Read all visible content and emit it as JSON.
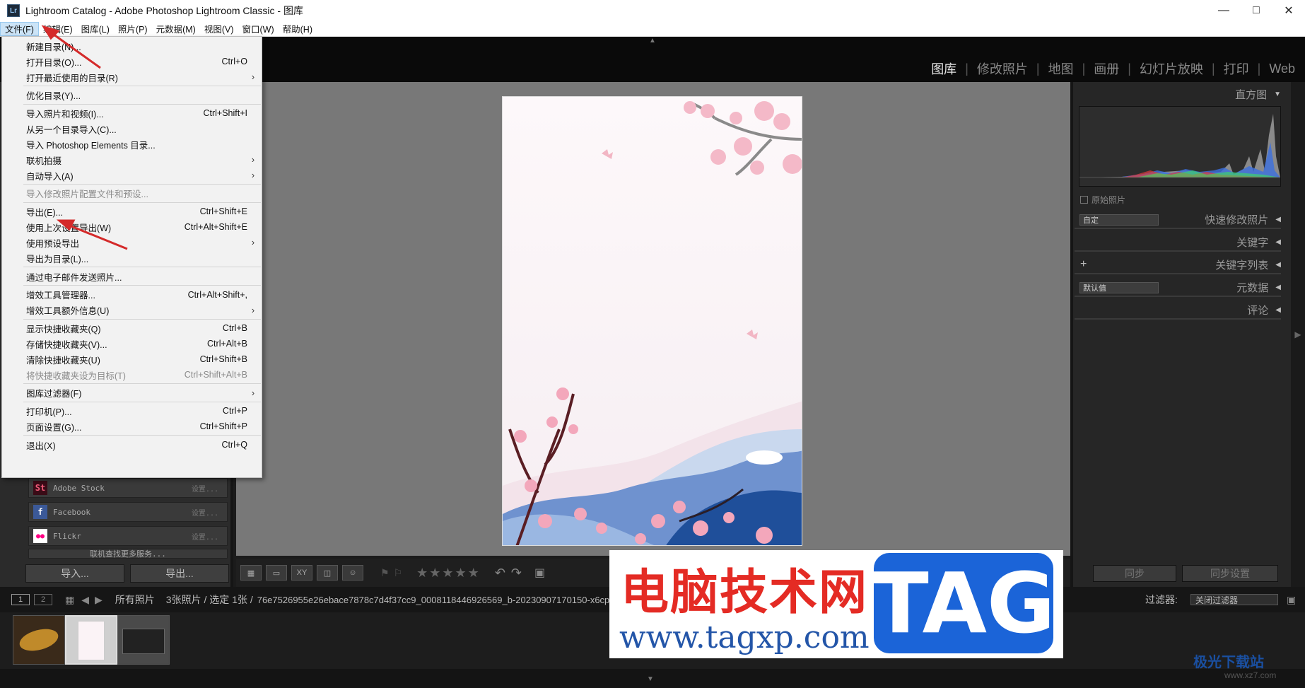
{
  "window": {
    "title": "Lightroom Catalog - Adobe Photoshop Lightroom Classic - 图库",
    "app_icon": "Lr"
  },
  "menubar": [
    "文件(F)",
    "编辑(E)",
    "图库(L)",
    "照片(P)",
    "元数据(M)",
    "视图(V)",
    "窗口(W)",
    "帮助(H)"
  ],
  "modules": [
    "图库",
    "修改照片",
    "地图",
    "画册",
    "幻灯片放映",
    "打印",
    "Web"
  ],
  "file_menu": [
    {
      "label": "新建目录(N)...",
      "shortcut": "",
      "submenu": false,
      "disabled": false
    },
    {
      "label": "打开目录(O)...",
      "shortcut": "Ctrl+O",
      "submenu": false,
      "disabled": false
    },
    {
      "label": "打开最近使用的目录(R)",
      "shortcut": "",
      "submenu": true,
      "disabled": false
    },
    {
      "label": "优化目录(Y)...",
      "shortcut": "",
      "submenu": false,
      "disabled": false
    },
    {
      "label": "导入照片和视频(I)...",
      "shortcut": "Ctrl+Shift+I",
      "submenu": false,
      "disabled": false
    },
    {
      "label": "从另一个目录导入(C)...",
      "shortcut": "",
      "submenu": false,
      "disabled": false
    },
    {
      "label": "导入 Photoshop Elements 目录...",
      "shortcut": "",
      "submenu": false,
      "disabled": false
    },
    {
      "label": "联机拍摄",
      "shortcut": "",
      "submenu": true,
      "disabled": false
    },
    {
      "label": "自动导入(A)",
      "shortcut": "",
      "submenu": true,
      "disabled": false
    },
    {
      "label": "导入修改照片配置文件和预设...",
      "shortcut": "",
      "submenu": false,
      "disabled": true
    },
    {
      "label": "导出(E)...",
      "shortcut": "Ctrl+Shift+E",
      "submenu": false,
      "disabled": false
    },
    {
      "label": "使用上次设置导出(W)",
      "shortcut": "Ctrl+Alt+Shift+E",
      "submenu": false,
      "disabled": false
    },
    {
      "label": "使用预设导出",
      "shortcut": "",
      "submenu": true,
      "disabled": false
    },
    {
      "label": "导出为目录(L)...",
      "shortcut": "",
      "submenu": false,
      "disabled": false
    },
    {
      "label": "通过电子邮件发送照片...",
      "shortcut": "",
      "submenu": false,
      "disabled": false
    },
    {
      "label": "增效工具管理器...",
      "shortcut": "Ctrl+Alt+Shift+,",
      "submenu": false,
      "disabled": false
    },
    {
      "label": "增效工具额外信息(U)",
      "shortcut": "",
      "submenu": true,
      "disabled": false
    },
    {
      "label": "显示快捷收藏夹(Q)",
      "shortcut": "Ctrl+B",
      "submenu": false,
      "disabled": false
    },
    {
      "label": "存储快捷收藏夹(V)...",
      "shortcut": "Ctrl+Alt+B",
      "submenu": false,
      "disabled": false
    },
    {
      "label": "清除快捷收藏夹(U)",
      "shortcut": "Ctrl+Shift+B",
      "submenu": false,
      "disabled": false
    },
    {
      "label": "将快捷收藏夹设为目标(T)",
      "shortcut": "Ctrl+Shift+Alt+B",
      "submenu": false,
      "disabled": true
    },
    {
      "label": "图库过滤器(F)",
      "shortcut": "",
      "submenu": true,
      "disabled": false
    },
    {
      "label": "打印机(P)...",
      "shortcut": "Ctrl+P",
      "submenu": false,
      "disabled": false
    },
    {
      "label": "页面设置(G)...",
      "shortcut": "Ctrl+Shift+P",
      "submenu": false,
      "disabled": false
    },
    {
      "label": "退出(X)",
      "shortcut": "Ctrl+Q",
      "submenu": false,
      "disabled": false
    }
  ],
  "publish": [
    {
      "icon": "St",
      "name": "Adobe Stock",
      "setting": "设置..."
    },
    {
      "icon": "f",
      "name": "Facebook",
      "setting": "设置..."
    },
    {
      "icon": "●●",
      "name": "Flickr",
      "setting": "设置..."
    }
  ],
  "publish_more": "联机查找更多服务...",
  "left_buttons": {
    "import": "导入...",
    "export": "导出..."
  },
  "right_panel": {
    "histogram": "直方图",
    "original_photo": "原始照片",
    "quick_develop": "快速修改照片",
    "preset": "自定",
    "keywords": "关键字",
    "keyword_list": "关键字列表",
    "metadata": "元数据",
    "metadata_preset": "默认值",
    "comments": "评论",
    "sync": "同步",
    "sync_settings": "同步设置"
  },
  "filmbar": {
    "source": "所有照片",
    "info": "3张照片 / 选定 1张 /",
    "filename": "76e7526955e26ebace7878c7d4f37cc9_0008118446926569_b-20230907170150-x6cpn94.jpg",
    "filter_label": "过滤器:",
    "filter_value": "关闭过滤器",
    "page1": "1",
    "page2": "2"
  },
  "watermark": {
    "cn": "电脑技术网",
    "url": "www.tagxp.com",
    "tag": "TAG",
    "corner": "极光下载站",
    "corner_url": "www.xz7.com"
  }
}
